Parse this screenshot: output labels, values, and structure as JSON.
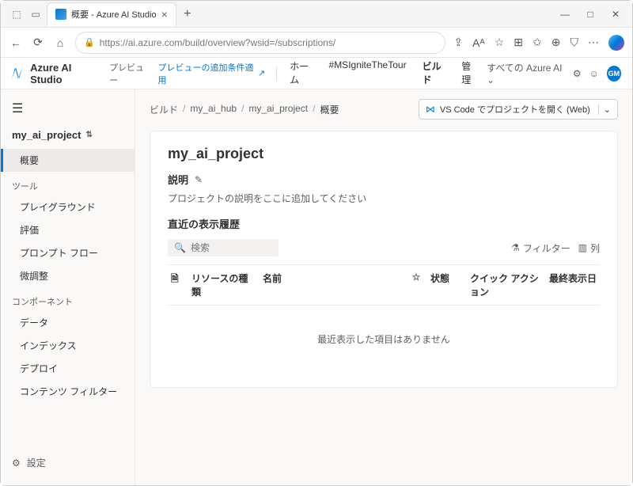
{
  "browser": {
    "tab_title": "概要 - Azure AI Studio",
    "url": "https://ai.azure.com/build/overview?wsid=/subscriptions/"
  },
  "app_header": {
    "title": "Azure AI Studio",
    "preview": "プレビュー",
    "preview_terms": "プレビューの追加条件適用",
    "nav": {
      "home": "ホーム",
      "ignite": "#MSIgniteTheTour",
      "build": "ビルド",
      "manage": "管理"
    },
    "workspace": "すべての Azure AI",
    "avatar": "GM"
  },
  "sidebar": {
    "project": "my_ai_project",
    "overview": "概要",
    "section_tools": "ツール",
    "playground": "プレイグラウンド",
    "evaluation": "評価",
    "prompt_flow": "プロンプト フロー",
    "fine_tune": "微調整",
    "section_components": "コンポーネント",
    "data": "データ",
    "indexes": "インデックス",
    "deploy": "デプロイ",
    "content_filter": "コンテンツ フィルター",
    "settings": "設定"
  },
  "breadcrumb": {
    "build": "ビルド",
    "hub": "my_ai_hub",
    "project": "my_ai_project",
    "overview": "概要"
  },
  "vscode_button": "VS Code でプロジェクトを開く (Web)",
  "content": {
    "title": "my_ai_project",
    "desc_label": "説明",
    "desc_placeholder": "プロジェクトの説明をここに追加してください",
    "recent_label": "直近の表示履歴",
    "search_placeholder": "検索",
    "filter": "フィルター",
    "columns": "列",
    "table_headers": {
      "type": "リソースの種類",
      "name": "名前",
      "state": "状態",
      "quick_action": "クイック アクション",
      "last_shown": "最終表示日"
    },
    "empty": "最近表示した項目はありません"
  }
}
